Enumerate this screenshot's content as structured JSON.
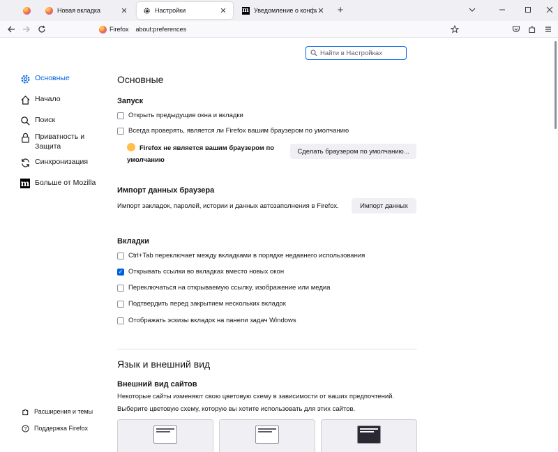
{
  "tabs": [
    {
      "label": "Новая вкладка"
    },
    {
      "label": "Настройки"
    },
    {
      "label": "Уведомление о конфиденциальности"
    }
  ],
  "urlbar": {
    "identity": "Firefox",
    "url": "about:preferences"
  },
  "search": {
    "placeholder": "Найти в Настройках"
  },
  "sidebar": {
    "items": [
      {
        "label": "Основные",
        "icon": "gear-icon",
        "active": true
      },
      {
        "label": "Начало",
        "icon": "home-icon"
      },
      {
        "label": "Поиск",
        "icon": "search-icon"
      },
      {
        "label": "Приватность и Защита",
        "icon": "lock-icon"
      },
      {
        "label": "Синхронизация",
        "icon": "sync-icon"
      },
      {
        "label": "Больше от Mozilla",
        "icon": "mozilla-icon"
      }
    ],
    "footer": [
      {
        "label": "Расширения и темы",
        "icon": "puzzle-icon"
      },
      {
        "label": "Поддержка Firefox",
        "icon": "help-icon"
      }
    ]
  },
  "main": {
    "title": "Основные",
    "startup": {
      "heading": "Запуск",
      "restore": "Открыть предыдущие окна и вкладки",
      "check_default": "Всегда проверять, является ли Firefox вашим браузером по умолчанию",
      "warning": "Firefox не является вашим браузером по умолчанию",
      "make_default_button": "Сделать браузером по умолчанию..."
    },
    "import": {
      "heading": "Импорт данных браузера",
      "description": "Импорт закладок, паролей, истории и данных автозаполнения в Firefox.",
      "button": "Импорт данных"
    },
    "tabs_section": {
      "heading": "Вкладки",
      "options": [
        {
          "label": "Ctrl+Tab переключает между вкладками в порядке недавнего использования",
          "checked": false
        },
        {
          "label": "Открывать ссылки во вкладках вместо новых окон",
          "checked": true
        },
        {
          "label": "Переключаться на открываемую ссылку, изображение или медиа",
          "checked": false
        },
        {
          "label": "Подтвердить перед закрытием нескольких вкладок",
          "checked": false
        },
        {
          "label": "Отображать эскизы вкладок на панели задач Windows",
          "checked": false
        }
      ]
    },
    "language": {
      "title": "Язык и внешний вид",
      "appearance_heading": "Внешний вид сайтов",
      "appearance_desc1": "Некоторые сайты изменяют свою цветовую схему в зависимости от ваших предпочтений.",
      "appearance_desc2": "Выберите цветовую схему, которую вы хотите использовать для этих сайтов."
    }
  },
  "colors": {
    "accent": "#0061e0"
  }
}
